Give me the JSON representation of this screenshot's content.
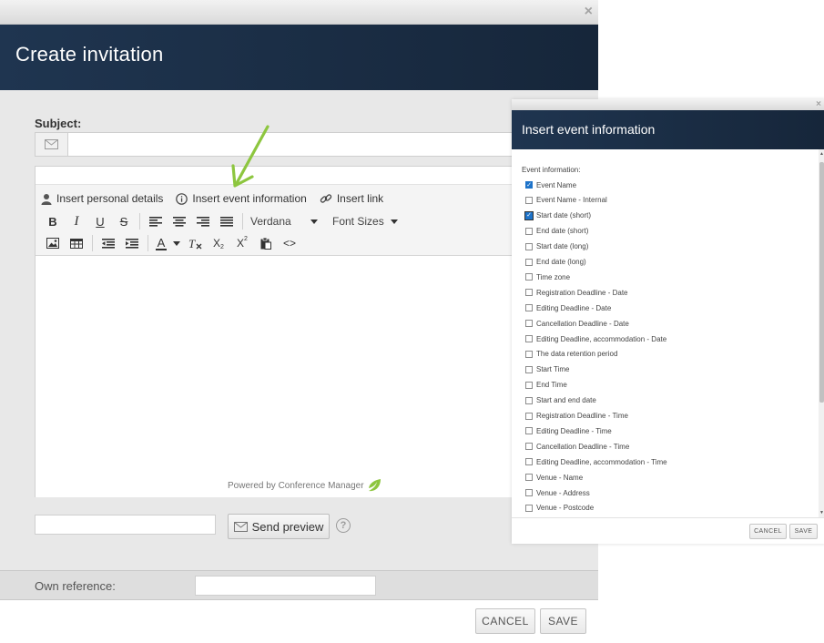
{
  "main": {
    "title": "Create invitation",
    "close": "×",
    "subject_label": "Subject:",
    "subject_value": "",
    "toolbar": {
      "insert_personal_details": "Insert personal details",
      "insert_event_information": "Insert event information",
      "insert_link": "Insert link",
      "font_family": "Verdana",
      "font_size": "Font Sizes",
      "bold": "B",
      "italic": "I",
      "underline": "U",
      "strike": "S",
      "font_color": "A",
      "subscript": "X",
      "subscript_mark": "2",
      "superscript": "X",
      "superscript_mark": "2",
      "source": "<>"
    },
    "powered_by": "Powered by Conference Manager",
    "preview_email_value": "",
    "send_preview_label": "Send preview",
    "help": "?",
    "own_reference_label": "Own reference:",
    "own_reference_value": "",
    "cancel_label": "CANCEL",
    "save_label": "SAVE"
  },
  "event_panel": {
    "title": "Insert event information",
    "close": "×",
    "section_label": "Event information:",
    "items": [
      {
        "label": "Event Name",
        "checked": true
      },
      {
        "label": "Event Name - Internal",
        "checked": false
      },
      {
        "label": "Start date (short)",
        "checked": true
      },
      {
        "label": "End date (short)",
        "checked": false
      },
      {
        "label": "Start date (long)",
        "checked": false
      },
      {
        "label": "End date (long)",
        "checked": false
      },
      {
        "label": "Time zone",
        "checked": false
      },
      {
        "label": "Registration Deadline - Date",
        "checked": false
      },
      {
        "label": "Editing Deadline - Date",
        "checked": false
      },
      {
        "label": "Cancellation Deadline - Date",
        "checked": false
      },
      {
        "label": "Editing Deadline, accommodation - Date",
        "checked": false
      },
      {
        "label": "The data retention period",
        "checked": false
      },
      {
        "label": "Start Time",
        "checked": false
      },
      {
        "label": "End Time",
        "checked": false
      },
      {
        "label": "Start and end date",
        "checked": false
      },
      {
        "label": "Registration Deadline - Time",
        "checked": false
      },
      {
        "label": "Editing Deadline - Time",
        "checked": false
      },
      {
        "label": "Cancellation Deadline - Time",
        "checked": false
      },
      {
        "label": "Editing Deadline, accommodation - Time",
        "checked": false
      },
      {
        "label": "Venue - Name",
        "checked": false
      },
      {
        "label": "Venue - Address",
        "checked": false
      },
      {
        "label": "Venue - Postcode",
        "checked": false
      }
    ],
    "cancel_label": "CANCEL",
    "save_label": "SAVE"
  },
  "colors": {
    "header_dark": "#1a2c43",
    "annotation_arrow": "#8dc63f",
    "checkbox_checked": "#1e73c9"
  }
}
